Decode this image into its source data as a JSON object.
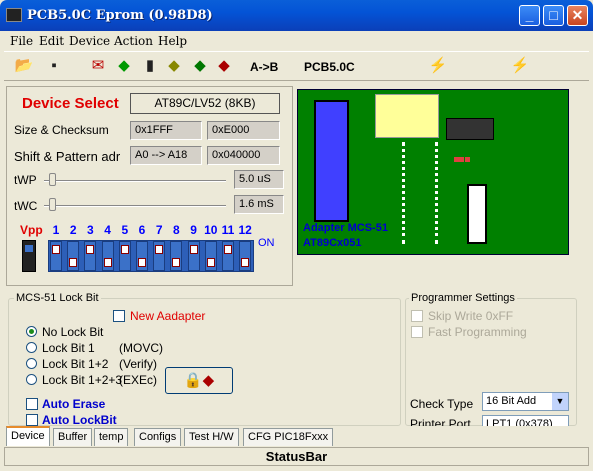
{
  "window": {
    "title": "PCB5.0C Eprom (0.98D8)",
    "minimize": "_",
    "maximize": "□",
    "close": "✕"
  },
  "menu": [
    "File",
    "Edit",
    "Device",
    "Action",
    "Help"
  ],
  "toolbar": {
    "ab_label": "A->B",
    "version_label": "PCB5.0C"
  },
  "device": {
    "select_label": "Device Select",
    "device_button": "AT89C/LV52    (8KB)",
    "size_label": "Size & Checksum",
    "size_value": "0x1FFF",
    "checksum_value": "0xE000",
    "shift_label": "Shift & Pattern adr",
    "shift_value": "A0 --> A18",
    "pattern_value": "0x040000",
    "twp_label": "tWP",
    "twp_value": "5.0 uS",
    "twp_level": 0.03,
    "twc_label": "tWC",
    "twc_value": "1.6 mS",
    "twc_level": 0.03,
    "vpp_label": "Vpp",
    "dip_numbers": [
      "1",
      "2",
      "3",
      "4",
      "5",
      "6",
      "7",
      "8",
      "9",
      "10",
      "11",
      "12"
    ],
    "on_label": "ON"
  },
  "board": {
    "line1": "Adapter MCS-51",
    "line2": "AT89Cx051"
  },
  "lock": {
    "group_title": "MCS-51 Lock Bit",
    "new_adapter": "New Aadapter",
    "options": [
      {
        "label": "No Lock Bit",
        "note": ""
      },
      {
        "label": "Lock Bit 1",
        "note": "(MOVC)"
      },
      {
        "label": "Lock Bit 1+2",
        "note": "(Verify)"
      },
      {
        "label": "Lock Bit 1+2+3",
        "note": "(EXEc)"
      }
    ],
    "auto_erase": "Auto Erase",
    "auto_lockbit": "Auto LockBit"
  },
  "settings": {
    "group_title": "Programmer Settings",
    "skip_write": "Skip Write 0xFF",
    "fast_programming": "Fast Programming",
    "check_type_label": "Check Type",
    "check_type_value": "16 Bit Add",
    "printer_port_label": "Printer Port",
    "printer_port_value": "LPT1 (0x378)"
  },
  "tabs": [
    "Device",
    "Buffer",
    "temp",
    "Configs",
    "Test H/W",
    "CFG PIC18Fxxx"
  ],
  "statusbar": "StatusBar",
  "colors": {
    "title_bar": "#0453d6",
    "device_select": "#e00000",
    "dip_blue": "#3b71c8",
    "board_green": "#008000"
  }
}
